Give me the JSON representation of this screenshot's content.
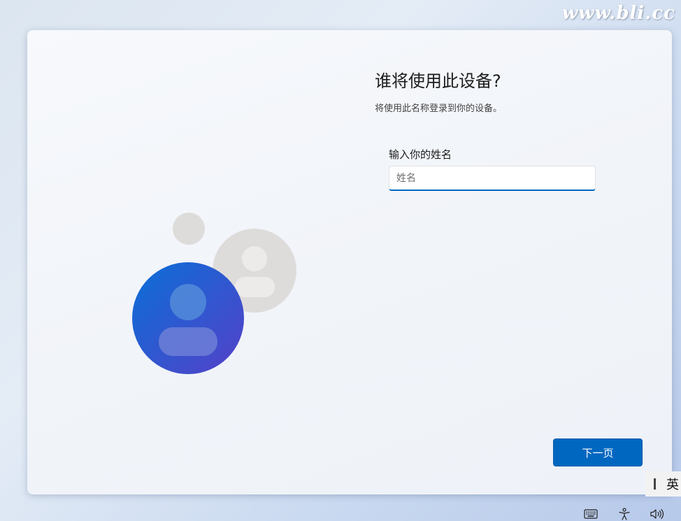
{
  "watermark": "www.bli.cc",
  "setup": {
    "title": "谁将使用此设备?",
    "subtitle": "将使用此名称登录到你的设备。",
    "name_label": "输入你的姓名",
    "name_placeholder": "姓名",
    "name_value": "",
    "next_label": "下一页"
  },
  "ime": {
    "mode_label": "英"
  },
  "tray": {
    "icons": [
      "keyboard-icon",
      "accessibility-icon",
      "volume-icon"
    ]
  },
  "colors": {
    "accent": "#0067c0",
    "avatar_blue_top": "#1a6ed6",
    "avatar_blue_bottom": "#4a3fc9",
    "avatar_grey": "#dedcdb"
  }
}
